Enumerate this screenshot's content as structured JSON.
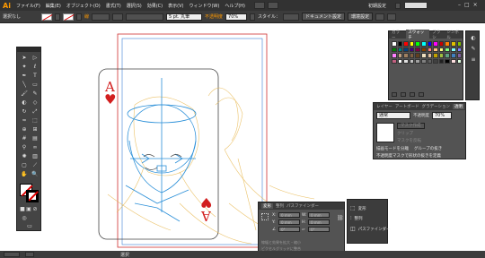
{
  "app": {
    "logo": "Ai"
  },
  "menu": [
    "ファイル(F)",
    "編集(E)",
    "オブジェクト(O)",
    "書式(T)",
    "選択(S)",
    "効果(C)",
    "表示(V)",
    "ウィンドウ(W)",
    "ヘルプ(H)"
  ],
  "workspace": {
    "label": "初期設定"
  },
  "control_bar": {
    "selection_status": "選択なし",
    "stroke_label": "線",
    "brush_label": "5 pt. 丸筆",
    "opacity_label": "不透明度",
    "opacity_value": "70%",
    "style_label": "スタイル：",
    "doc_setup_button": "ドキュメント設定",
    "prefs_button": "環境設定"
  },
  "card": {
    "rank": "A",
    "suit": "♥"
  },
  "swatches_panel": {
    "tabs": [
      "カラー",
      "スウォッチ",
      "ブラシ",
      "シンボル"
    ],
    "colors": [
      "#ffffff",
      "#000000",
      "#ff0000",
      "#ffff00",
      "#00ff00",
      "#00ffff",
      "#0000ff",
      "#ff00ff",
      "#c80000",
      "#ff8000",
      "#e0c000",
      "#80c000",
      "#008000",
      "#008080",
      "#004080",
      "#400080",
      "#800040",
      "#804000",
      "#ff8080",
      "#ffc080",
      "#ffff80",
      "#80ff80",
      "#80ffff",
      "#8080ff",
      "#ff80ff",
      "#c0a080",
      "#a08060",
      "#806040",
      "#604020",
      "#f0e0c0",
      "#e0c0a0",
      "#c0a000",
      "#a0c040",
      "#60a080",
      "#4080c0",
      "#8060a0",
      "#c06080",
      "#ffffff",
      "#e0e0e0",
      "#c0c0c0",
      "#a0a0a0",
      "#808080",
      "#606060",
      "#404040",
      "#202020",
      "#000000",
      "#ffe0e0",
      "#e0ffe0"
    ]
  },
  "transparency_panel": {
    "tabs": [
      "レイヤー",
      "アートボード",
      "グラデーション",
      "透明"
    ],
    "blend_mode": "通常",
    "opacity_label": "不透明度",
    "opacity_value": "70%",
    "mask_button": "マスク作成",
    "clip_label": "クリップ",
    "invert_label": "マスクを反転",
    "isolate_label": "描画モードを分離",
    "knockout_label": "グループの抜き",
    "opacity_mask_label": "不透明度マスクで形状の抜きを定義"
  },
  "transform_panel": {
    "tabs": [
      "変形",
      "整列",
      "パスファインダー"
    ],
    "x_label": "X:",
    "y_label": "Y:",
    "w_label": "W:",
    "h_label": "H:",
    "x_value": "0 mm",
    "y_value": "0 mm",
    "w_value": "0 mm",
    "h_value": "0 mm",
    "angle_value": "0°",
    "shear_value": "0°",
    "scale_strokes": "線幅と効果を拡大・縮小",
    "pixel_grid": "ピクセルグリッドに整合"
  },
  "mini_panel": {
    "items": [
      "変形",
      "整列",
      "パスファインダー"
    ]
  },
  "status_bar": {
    "zoom": "",
    "tool": "選択"
  },
  "colors": {
    "menubar": "#323232",
    "panel": "#535353",
    "accent_orange": "#ff9a00",
    "card_red": "#d21e1e",
    "guide_blue": "#2a8fd8",
    "sketch": "#e8b850"
  }
}
